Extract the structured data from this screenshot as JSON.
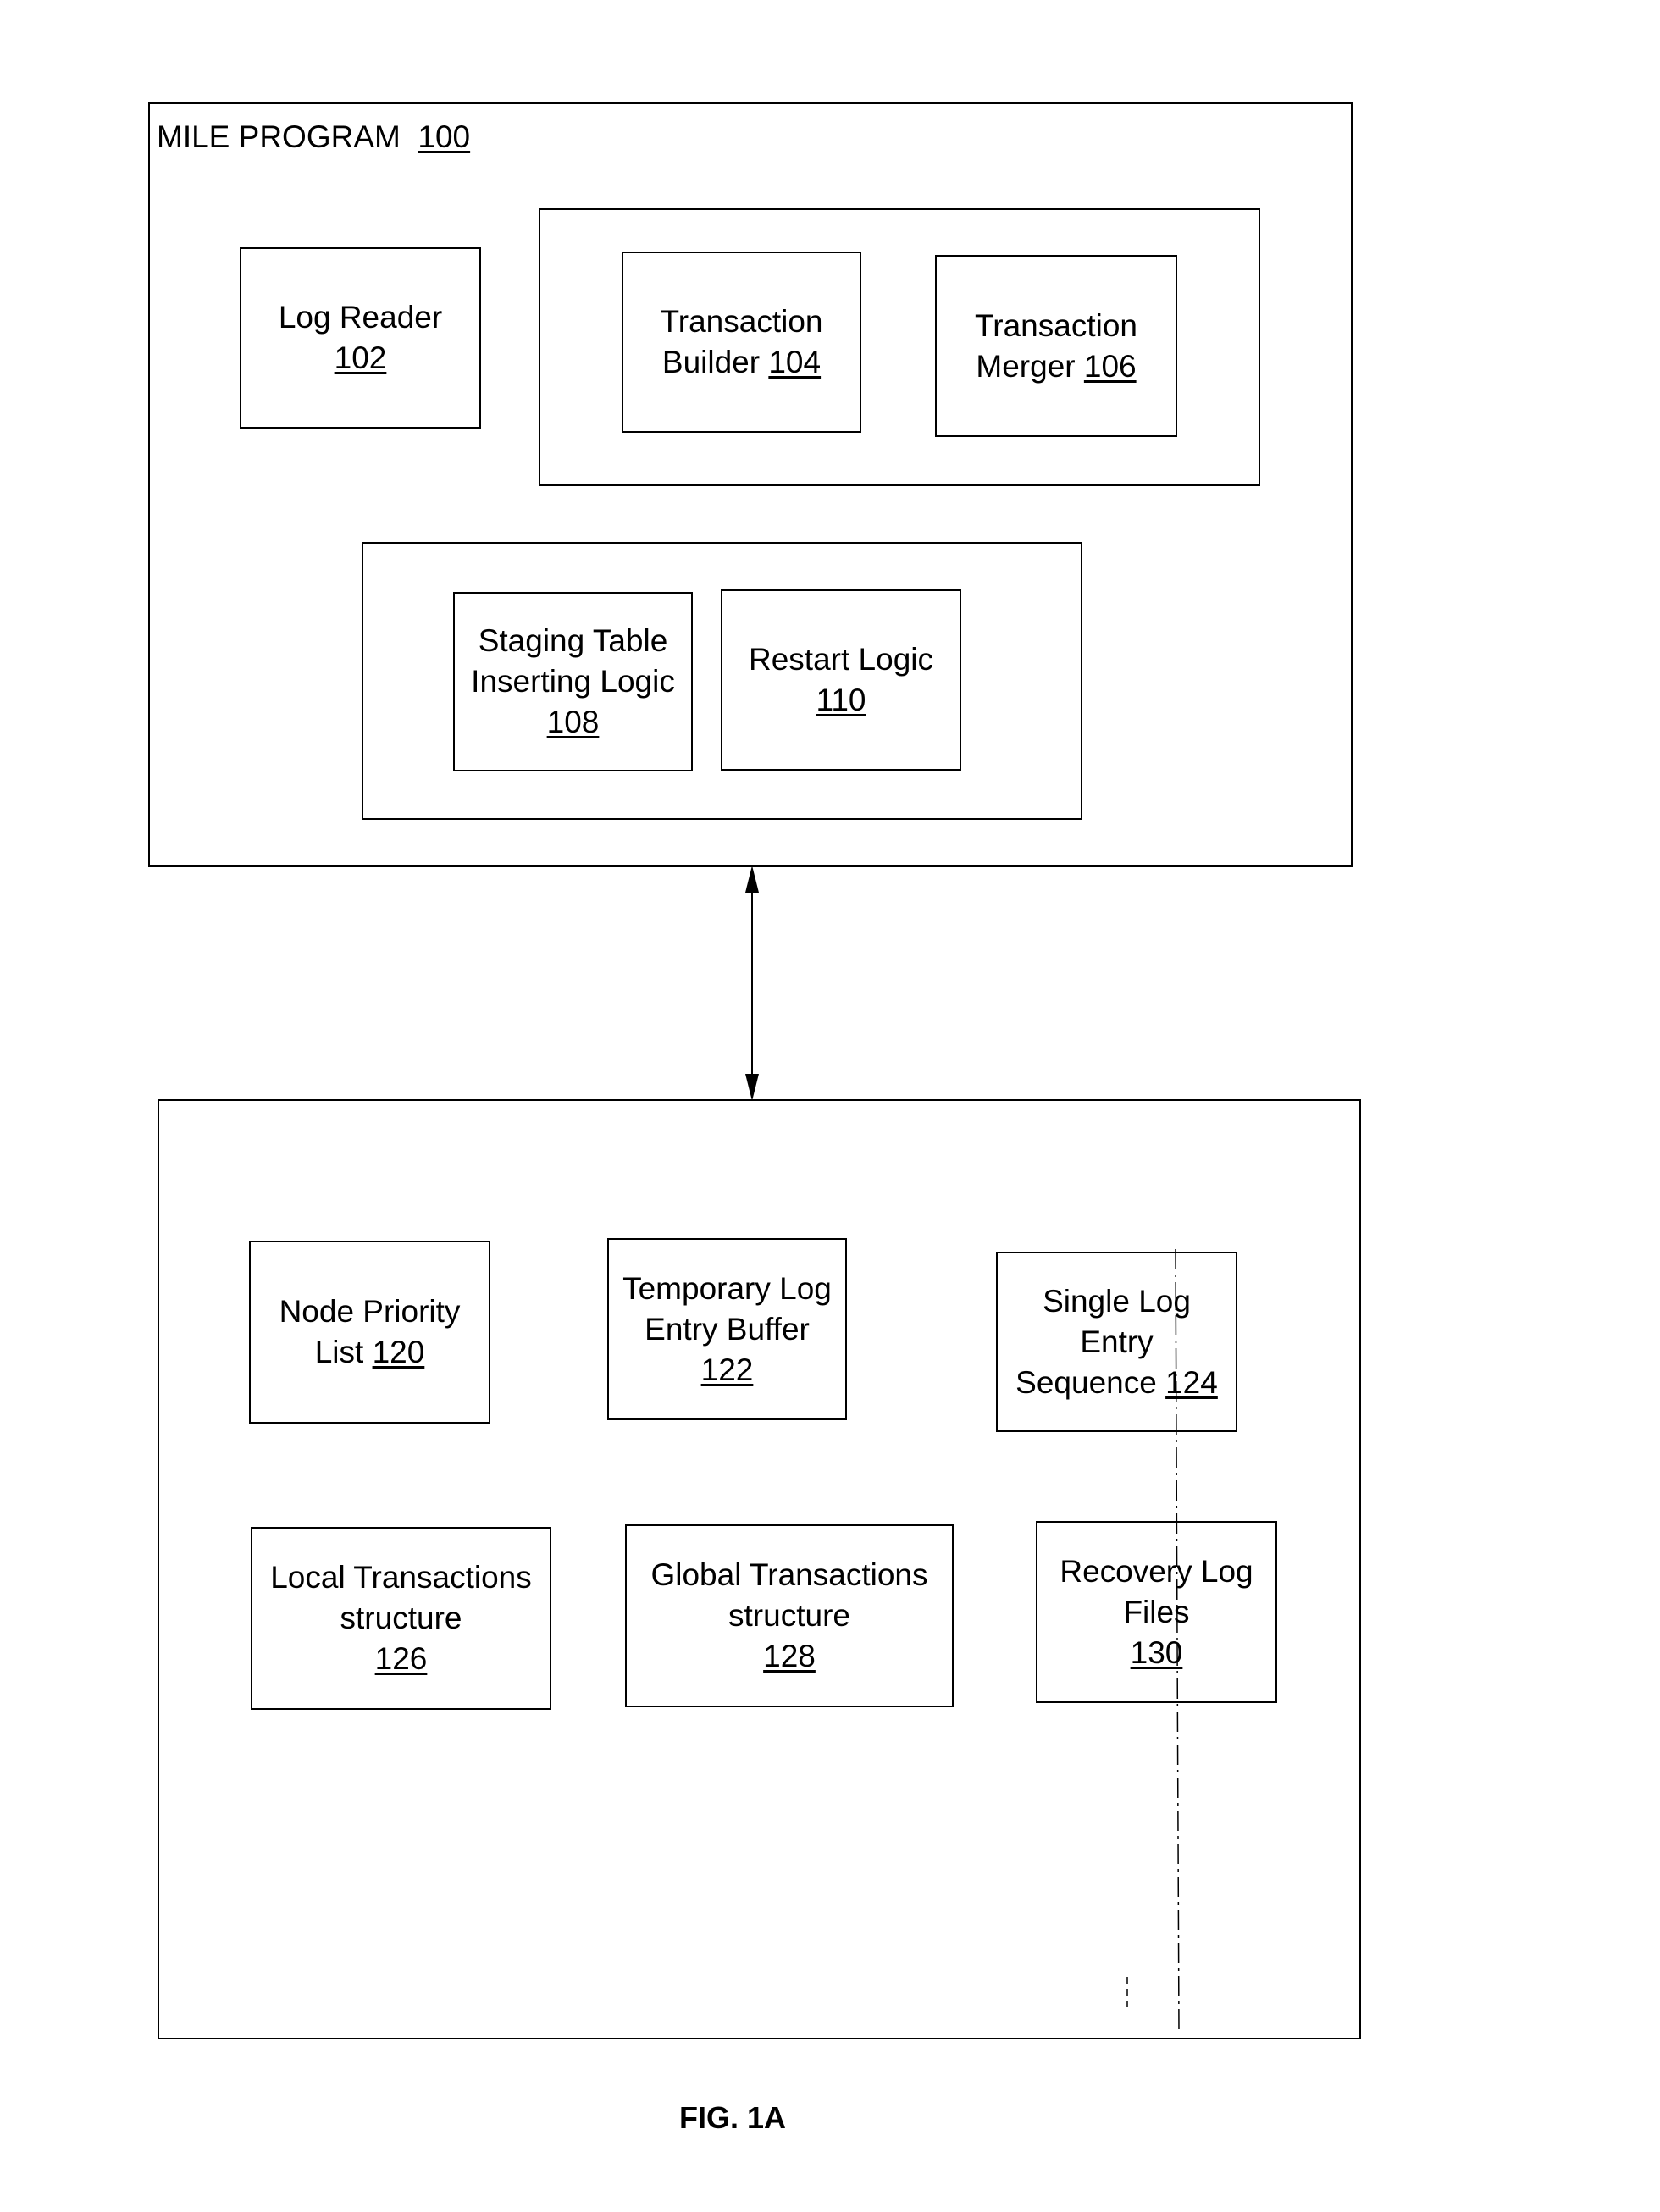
{
  "figure_label": "FIG. 1A",
  "mile_program": {
    "title": "MILE PROGRAM",
    "ref": "100",
    "components": {
      "log_reader": {
        "lines": [
          "Log Reader"
        ],
        "ref": "102"
      },
      "transaction_builder": {
        "lines": [
          "Transaction",
          "Builder"
        ],
        "ref": "104"
      },
      "transaction_merger": {
        "lines": [
          "Transaction",
          "Merger"
        ],
        "ref": "106"
      },
      "staging_table": {
        "lines": [
          "Staging Table",
          "Inserting Logic"
        ],
        "ref": "108"
      },
      "restart_logic": {
        "lines": [
          "Restart Logic"
        ],
        "ref": "110"
      }
    }
  },
  "data_store": {
    "components": {
      "node_priority_list": {
        "lines": [
          "Node Priority",
          "List"
        ],
        "ref": "120"
      },
      "temporary_log_buffer": {
        "lines": [
          "Temporary Log",
          "Entry Buffer"
        ],
        "ref": "122"
      },
      "single_log_entry_sequence": {
        "lines": [
          "Single Log",
          "Entry",
          "Sequence"
        ],
        "ref": "124"
      },
      "local_transactions": {
        "lines": [
          "Local Transactions",
          "structure"
        ],
        "ref": "126"
      },
      "global_transactions": {
        "lines": [
          "Global Transactions",
          "structure"
        ],
        "ref": "128"
      },
      "recovery_log_files": {
        "lines": [
          "Recovery Log",
          "Files"
        ],
        "ref": "130"
      }
    }
  }
}
